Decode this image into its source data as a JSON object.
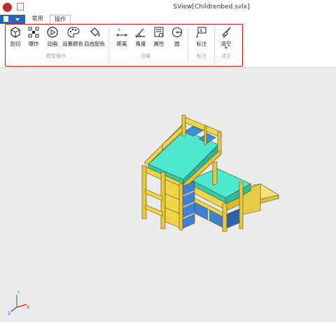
{
  "window": {
    "title": "SView[Childrenbed.svlx]"
  },
  "tabs": {
    "normal": "常用",
    "operations": "操作"
  },
  "tools": {
    "cut": "剖切",
    "explode": "爆炸",
    "animation": "动画",
    "set_color": "设置颜色",
    "free_color": "自由配色",
    "distance": "距离",
    "angle": "角度",
    "property": "属性",
    "circle": "圆",
    "annotate": "标注",
    "clear": "清空"
  },
  "groups": {
    "model_ops": "模型操作",
    "measure": "测量",
    "annotate": "标注",
    "clear": "清空"
  },
  "axes": {
    "x": "X",
    "y": "Y",
    "z": "Z"
  },
  "colors": {
    "bed_frame": "#f0d44a",
    "mattress": "#4ee8cf",
    "pillow": "#3a8ee0",
    "drawer": "#3f7fd6",
    "highlight": "#d11a1a"
  }
}
